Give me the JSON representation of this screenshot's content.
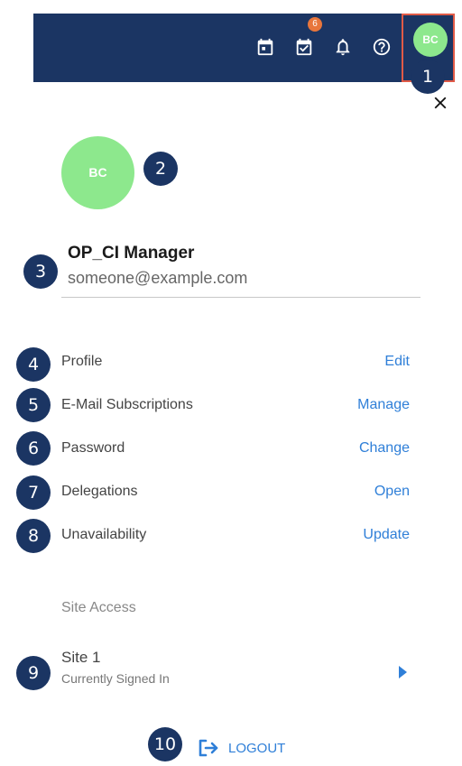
{
  "header": {
    "icons": [
      "calendar-icon",
      "tasks-check-icon",
      "bell-icon",
      "help-icon"
    ],
    "tasks_badge": "6",
    "avatar_initials": "BC"
  },
  "user": {
    "initials": "BC",
    "name": "OP_CI Manager",
    "email": "someone@example.com"
  },
  "settings": [
    {
      "label": "Profile",
      "action": "Edit"
    },
    {
      "label": "E-Mail Subscriptions",
      "action": "Manage"
    },
    {
      "label": "Password",
      "action": "Change"
    },
    {
      "label": "Delegations",
      "action": "Open"
    },
    {
      "label": "Unavailability",
      "action": "Update"
    }
  ],
  "site_access": {
    "heading": "Site Access",
    "site_name": "Site 1",
    "status": "Currently Signed In"
  },
  "logout_label": "LOGOUT",
  "markers": [
    "1",
    "2",
    "3",
    "4",
    "5",
    "6",
    "7",
    "8",
    "9",
    "10"
  ],
  "colors": {
    "header_bg": "#1b3563",
    "avatar_bg": "#8de88d",
    "link": "#2f7fd8",
    "badge": "#e8763c",
    "highlight": "#e05a47"
  }
}
